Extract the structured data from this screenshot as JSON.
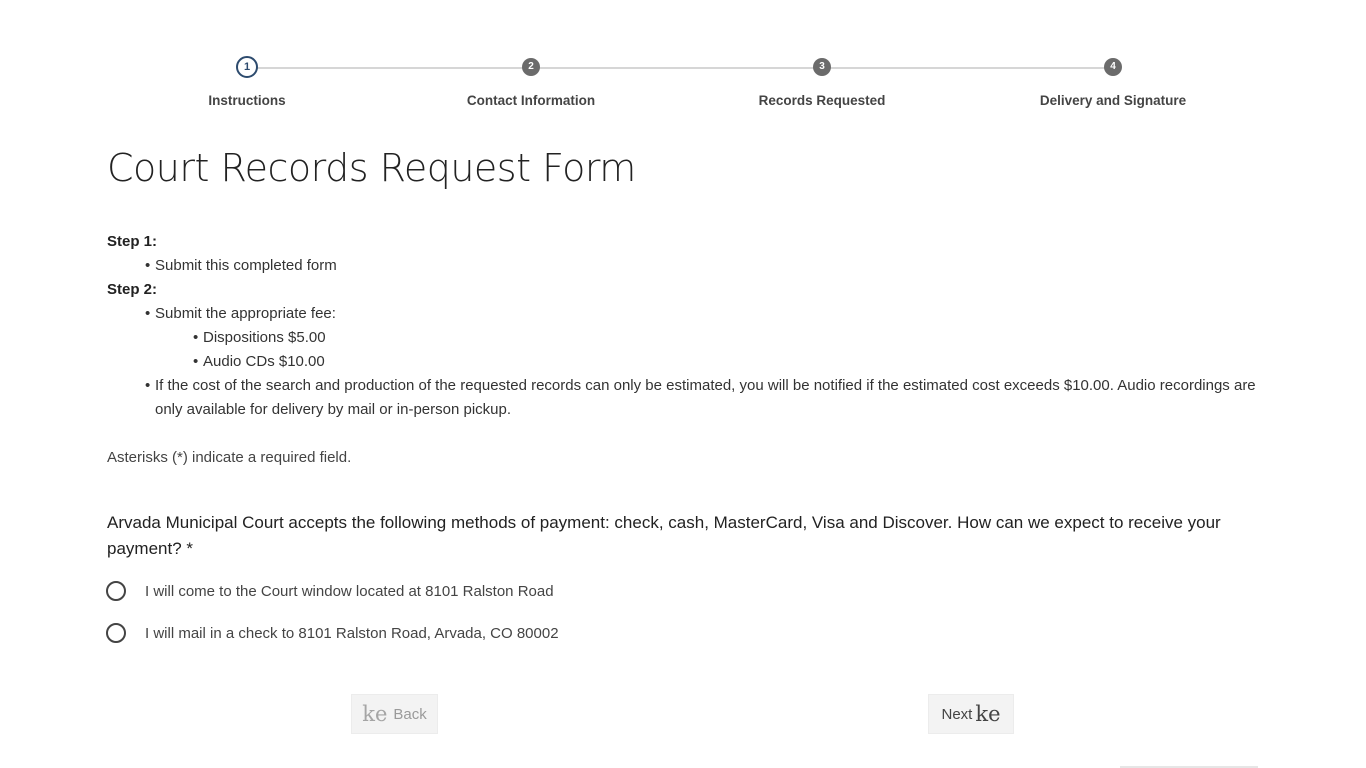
{
  "stepper": {
    "steps": [
      {
        "number": "1",
        "label": "Instructions",
        "state": "active"
      },
      {
        "number": "2",
        "label": "Contact Information",
        "state": "inactive"
      },
      {
        "number": "3",
        "label": "Records Requested",
        "state": "inactive"
      },
      {
        "number": "4",
        "label": "Delivery and Signature",
        "state": "inactive"
      }
    ]
  },
  "form": {
    "title": "Court Records Request Form",
    "step1_heading": "Step 1:",
    "step1_items": [
      "Submit this completed form"
    ],
    "step2_heading": "Step 2:",
    "step2_intro": "Submit the appropriate fee:",
    "step2_fees": [
      "Dispositions $5.00",
      "Audio CDs $10.00"
    ],
    "step2_note": "If the cost of the search and production of the requested records can only be estimated, you will be notified if the estimated cost exceeds $10.00. Audio recordings are only available for delivery by mail or in-person pickup.",
    "required_note": "Asterisks (*) indicate a required field.",
    "question": "Arvada Municipal Court accepts the following methods of payment: check, cash, MasterCard, Visa and Discover. How can we expect to receive your payment? *",
    "options": [
      "I will come to the Court window located at 8101 Ralston Road",
      "I will mail in a check to 8101 Ralston Road, Arvada, CO 80002"
    ]
  },
  "nav": {
    "back_label": "Back",
    "next_label": "Next",
    "back_icon": "ke",
    "next_icon": "ke"
  },
  "colors": {
    "active_step": "#2d4b6e",
    "inactive_step": "#6b6b6b",
    "button_bg": "#f3f3f3"
  }
}
